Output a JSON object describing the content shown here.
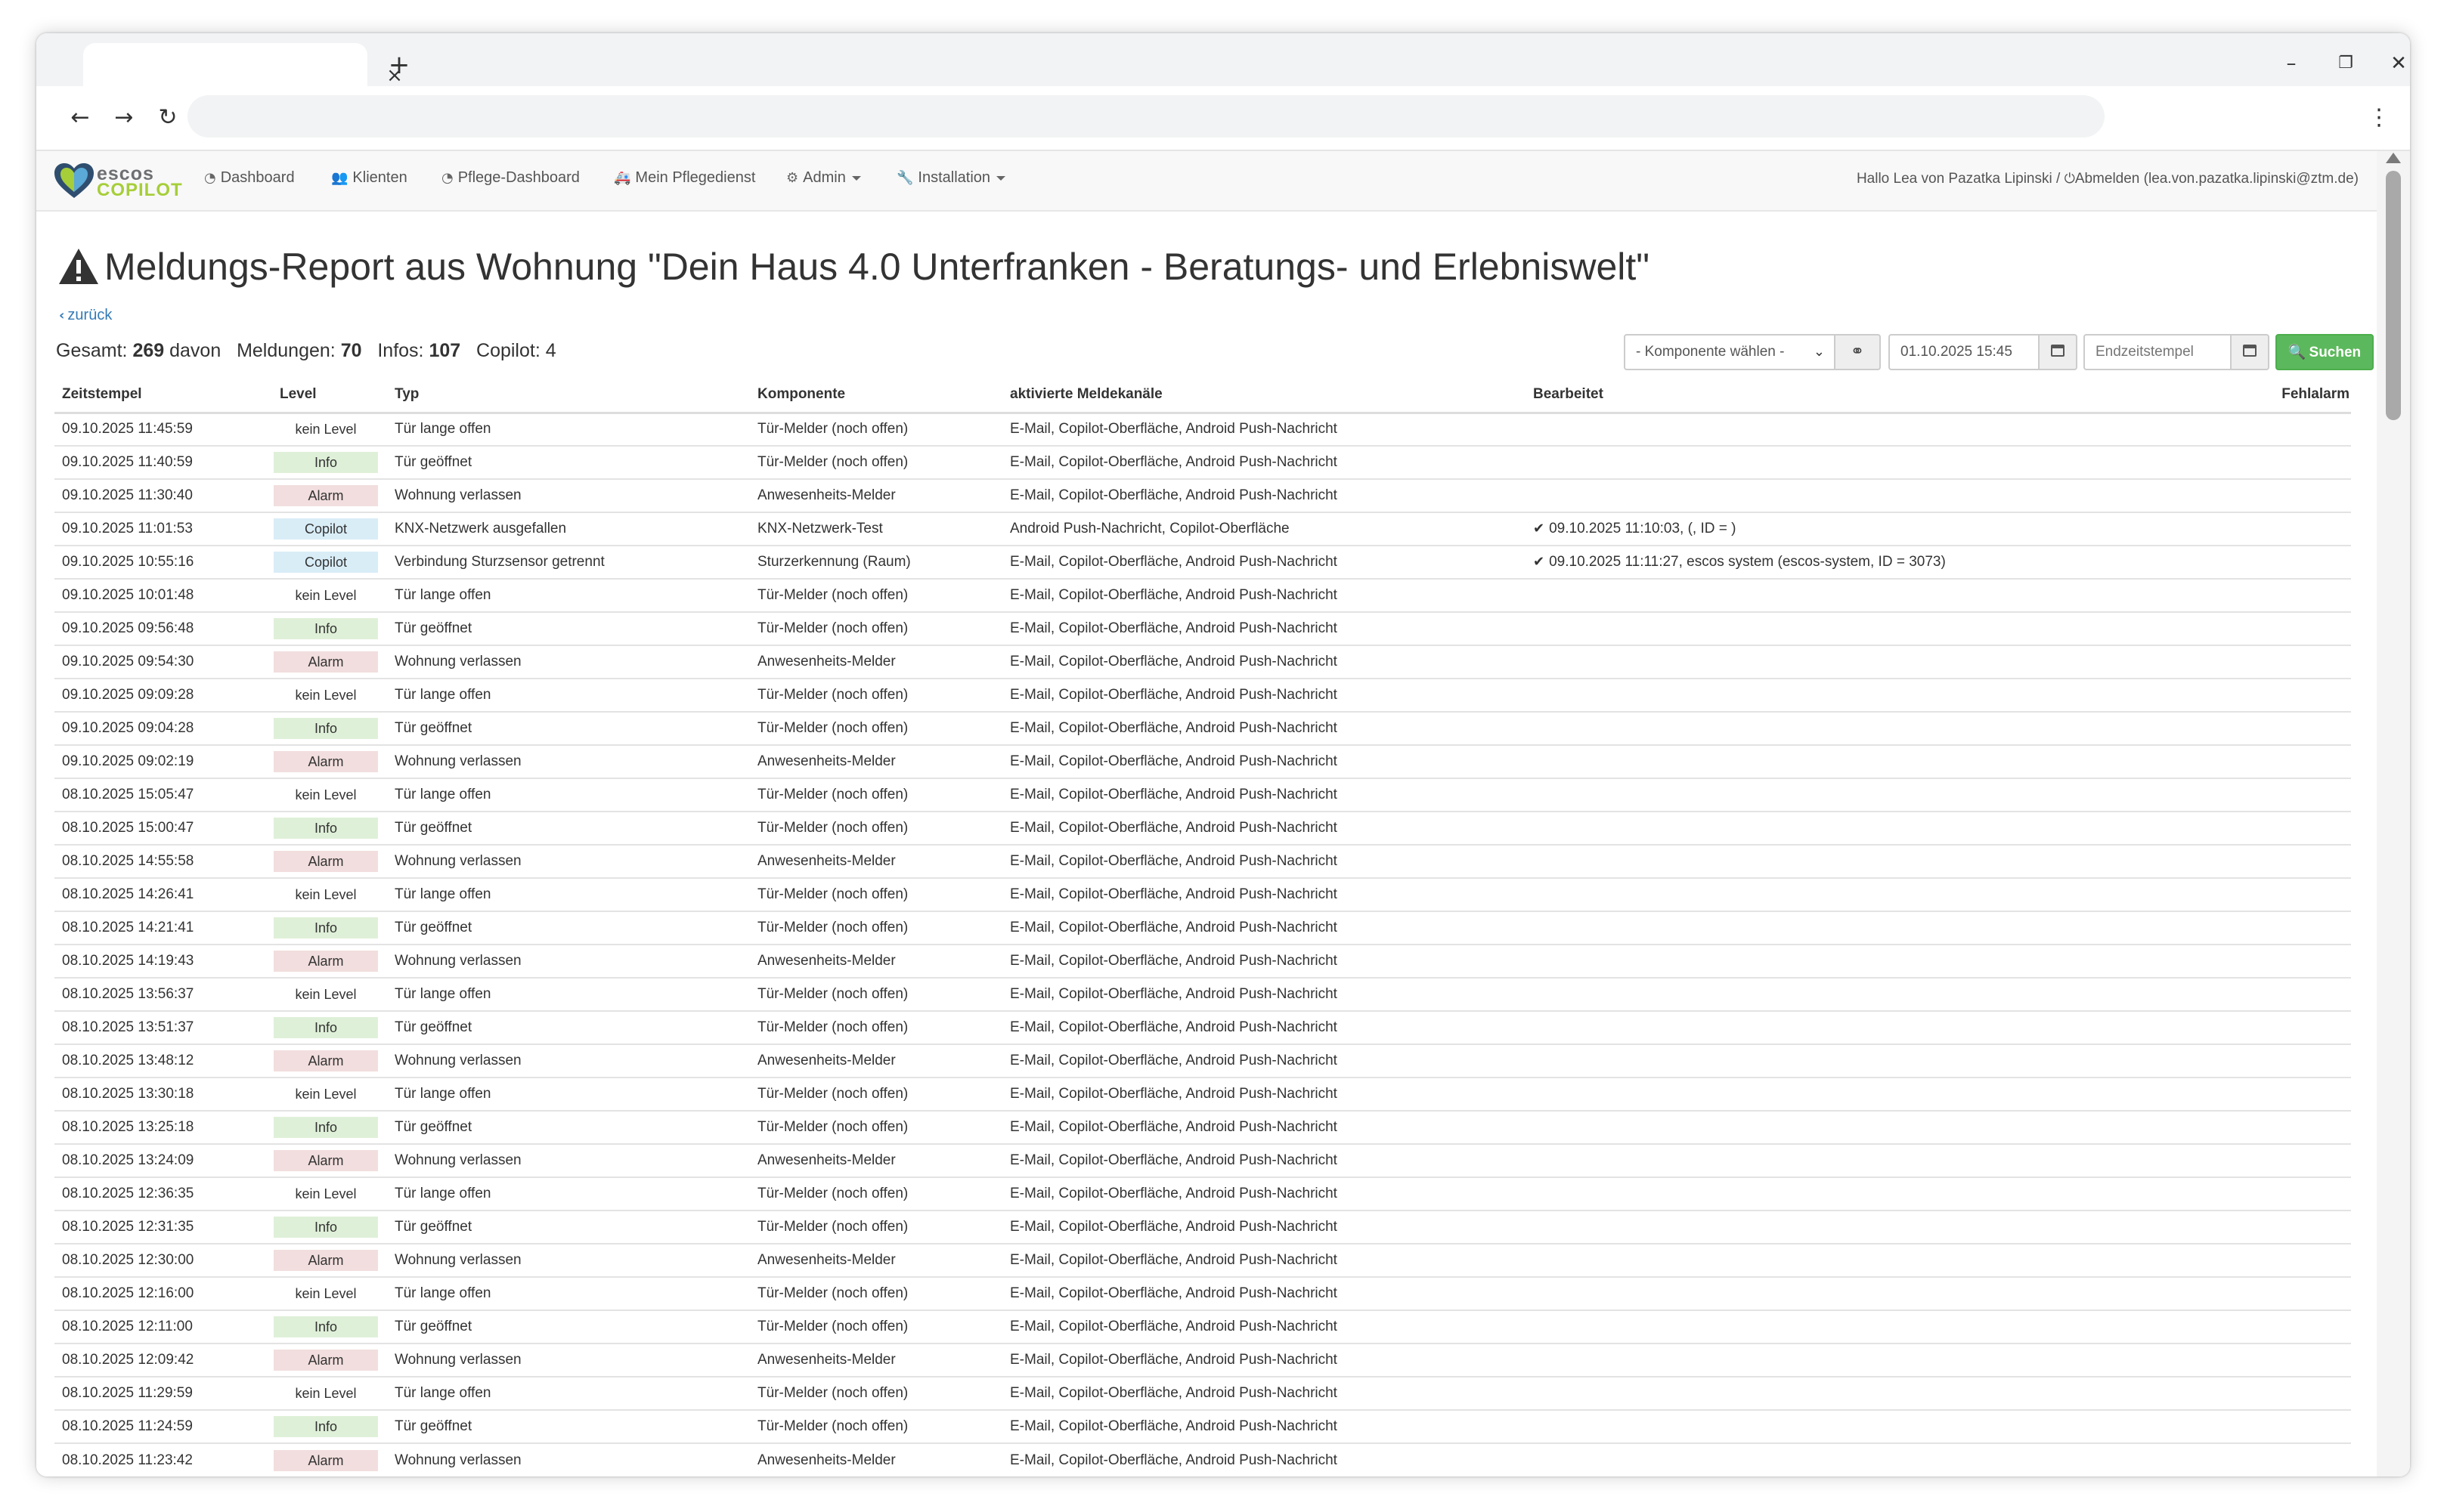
{
  "browser": {
    "tab_close": "×",
    "new_tab": "+",
    "address": "",
    "controls": {
      "minimize": "–",
      "restore": "❐",
      "close": "✕"
    }
  },
  "nav": {
    "logo_top": "escos",
    "logo_bottom": "COPILOT",
    "items": [
      {
        "label": "Dashboard",
        "icon": "dashboard-icon",
        "glyph": "◔",
        "dropdown": false
      },
      {
        "label": "Klienten",
        "icon": "users-icon",
        "glyph": "👥",
        "dropdown": false
      },
      {
        "label": "Pflege-Dashboard",
        "icon": "dashboard-icon",
        "glyph": "◔",
        "dropdown": false
      },
      {
        "label": "Mein Pflegedienst",
        "icon": "car-icon",
        "glyph": "🚑",
        "dropdown": false
      },
      {
        "label": "Admin",
        "icon": "gear-icon",
        "glyph": "⚙",
        "dropdown": true
      },
      {
        "label": "Installation",
        "icon": "wrench-icon",
        "glyph": "🔧",
        "dropdown": true
      }
    ],
    "greeting": "Hallo Lea von Pazatka Lipinski /",
    "logout": "Abmelden (lea.von.pazatka.lipinski@ztm.de)"
  },
  "page": {
    "title": "Meldungs-Report aus Wohnung \"Dein Haus 4.0 Unterfranken - Beratungs- und Erlebniswelt\"",
    "back": "zurück",
    "summary": {
      "total_label": "Gesamt:",
      "total": "269",
      "of_label": "davon",
      "messages_label": "Meldungen:",
      "messages": "70",
      "infos_label": "Infos:",
      "infos": "107",
      "copilot_label": "Copilot:",
      "copilot": "4"
    }
  },
  "filters": {
    "component_select": "- Komponente wählen -",
    "start": "01.10.2025 15:45",
    "end_placeholder": "Endzeitstempel",
    "search": "Suchen"
  },
  "table": {
    "headers": [
      "Zeitstempel",
      "Level",
      "Typ",
      "Komponente",
      "aktivierte Meldekanäle",
      "Bearbeitet",
      "Fehlalarm"
    ],
    "rows": [
      {
        "ts": "09.10.2025 11:45:59",
        "level": "kein Level",
        "type": "Tür lange offen",
        "comp": "Tür-Melder (noch offen)",
        "channels": "E-Mail, Copilot-Oberfläche, Android Push-Nachricht",
        "edited": ""
      },
      {
        "ts": "09.10.2025 11:40:59",
        "level": "Info",
        "type": "Tür geöffnet",
        "comp": "Tür-Melder (noch offen)",
        "channels": "E-Mail, Copilot-Oberfläche, Android Push-Nachricht",
        "edited": ""
      },
      {
        "ts": "09.10.2025 11:30:40",
        "level": "Alarm",
        "type": "Wohnung verlassen",
        "comp": "Anwesenheits-Melder",
        "channels": "E-Mail, Copilot-Oberfläche, Android Push-Nachricht",
        "edited": ""
      },
      {
        "ts": "09.10.2025 11:01:53",
        "level": "Copilot",
        "type": "KNX-Netzwerk ausgefallen",
        "comp": "KNX-Netzwerk-Test",
        "channels": "Android Push-Nachricht, Copilot-Oberfläche",
        "edited": "09.10.2025 11:10:03, (, ID = )"
      },
      {
        "ts": "09.10.2025 10:55:16",
        "level": "Copilot",
        "type": "Verbindung Sturzsensor getrennt",
        "comp": "Sturzerkennung (Raum)",
        "channels": "E-Mail, Copilot-Oberfläche, Android Push-Nachricht",
        "edited": "09.10.2025 11:11:27, escos system (escos-system, ID = 3073)"
      },
      {
        "ts": "09.10.2025 10:01:48",
        "level": "kein Level",
        "type": "Tür lange offen",
        "comp": "Tür-Melder (noch offen)",
        "channels": "E-Mail, Copilot-Oberfläche, Android Push-Nachricht",
        "edited": ""
      },
      {
        "ts": "09.10.2025 09:56:48",
        "level": "Info",
        "type": "Tür geöffnet",
        "comp": "Tür-Melder (noch offen)",
        "channels": "E-Mail, Copilot-Oberfläche, Android Push-Nachricht",
        "edited": ""
      },
      {
        "ts": "09.10.2025 09:54:30",
        "level": "Alarm",
        "type": "Wohnung verlassen",
        "comp": "Anwesenheits-Melder",
        "channels": "E-Mail, Copilot-Oberfläche, Android Push-Nachricht",
        "edited": ""
      },
      {
        "ts": "09.10.2025 09:09:28",
        "level": "kein Level",
        "type": "Tür lange offen",
        "comp": "Tür-Melder (noch offen)",
        "channels": "E-Mail, Copilot-Oberfläche, Android Push-Nachricht",
        "edited": ""
      },
      {
        "ts": "09.10.2025 09:04:28",
        "level": "Info",
        "type": "Tür geöffnet",
        "comp": "Tür-Melder (noch offen)",
        "channels": "E-Mail, Copilot-Oberfläche, Android Push-Nachricht",
        "edited": ""
      },
      {
        "ts": "09.10.2025 09:02:19",
        "level": "Alarm",
        "type": "Wohnung verlassen",
        "comp": "Anwesenheits-Melder",
        "channels": "E-Mail, Copilot-Oberfläche, Android Push-Nachricht",
        "edited": ""
      },
      {
        "ts": "08.10.2025 15:05:47",
        "level": "kein Level",
        "type": "Tür lange offen",
        "comp": "Tür-Melder (noch offen)",
        "channels": "E-Mail, Copilot-Oberfläche, Android Push-Nachricht",
        "edited": ""
      },
      {
        "ts": "08.10.2025 15:00:47",
        "level": "Info",
        "type": "Tür geöffnet",
        "comp": "Tür-Melder (noch offen)",
        "channels": "E-Mail, Copilot-Oberfläche, Android Push-Nachricht",
        "edited": ""
      },
      {
        "ts": "08.10.2025 14:55:58",
        "level": "Alarm",
        "type": "Wohnung verlassen",
        "comp": "Anwesenheits-Melder",
        "channels": "E-Mail, Copilot-Oberfläche, Android Push-Nachricht",
        "edited": ""
      },
      {
        "ts": "08.10.2025 14:26:41",
        "level": "kein Level",
        "type": "Tür lange offen",
        "comp": "Tür-Melder (noch offen)",
        "channels": "E-Mail, Copilot-Oberfläche, Android Push-Nachricht",
        "edited": ""
      },
      {
        "ts": "08.10.2025 14:21:41",
        "level": "Info",
        "type": "Tür geöffnet",
        "comp": "Tür-Melder (noch offen)",
        "channels": "E-Mail, Copilot-Oberfläche, Android Push-Nachricht",
        "edited": ""
      },
      {
        "ts": "08.10.2025 14:19:43",
        "level": "Alarm",
        "type": "Wohnung verlassen",
        "comp": "Anwesenheits-Melder",
        "channels": "E-Mail, Copilot-Oberfläche, Android Push-Nachricht",
        "edited": ""
      },
      {
        "ts": "08.10.2025 13:56:37",
        "level": "kein Level",
        "type": "Tür lange offen",
        "comp": "Tür-Melder (noch offen)",
        "channels": "E-Mail, Copilot-Oberfläche, Android Push-Nachricht",
        "edited": ""
      },
      {
        "ts": "08.10.2025 13:51:37",
        "level": "Info",
        "type": "Tür geöffnet",
        "comp": "Tür-Melder (noch offen)",
        "channels": "E-Mail, Copilot-Oberfläche, Android Push-Nachricht",
        "edited": ""
      },
      {
        "ts": "08.10.2025 13:48:12",
        "level": "Alarm",
        "type": "Wohnung verlassen",
        "comp": "Anwesenheits-Melder",
        "channels": "E-Mail, Copilot-Oberfläche, Android Push-Nachricht",
        "edited": ""
      },
      {
        "ts": "08.10.2025 13:30:18",
        "level": "kein Level",
        "type": "Tür lange offen",
        "comp": "Tür-Melder (noch offen)",
        "channels": "E-Mail, Copilot-Oberfläche, Android Push-Nachricht",
        "edited": ""
      },
      {
        "ts": "08.10.2025 13:25:18",
        "level": "Info",
        "type": "Tür geöffnet",
        "comp": "Tür-Melder (noch offen)",
        "channels": "E-Mail, Copilot-Oberfläche, Android Push-Nachricht",
        "edited": ""
      },
      {
        "ts": "08.10.2025 13:24:09",
        "level": "Alarm",
        "type": "Wohnung verlassen",
        "comp": "Anwesenheits-Melder",
        "channels": "E-Mail, Copilot-Oberfläche, Android Push-Nachricht",
        "edited": ""
      },
      {
        "ts": "08.10.2025 12:36:35",
        "level": "kein Level",
        "type": "Tür lange offen",
        "comp": "Tür-Melder (noch offen)",
        "channels": "E-Mail, Copilot-Oberfläche, Android Push-Nachricht",
        "edited": ""
      },
      {
        "ts": "08.10.2025 12:31:35",
        "level": "Info",
        "type": "Tür geöffnet",
        "comp": "Tür-Melder (noch offen)",
        "channels": "E-Mail, Copilot-Oberfläche, Android Push-Nachricht",
        "edited": ""
      },
      {
        "ts": "08.10.2025 12:30:00",
        "level": "Alarm",
        "type": "Wohnung verlassen",
        "comp": "Anwesenheits-Melder",
        "channels": "E-Mail, Copilot-Oberfläche, Android Push-Nachricht",
        "edited": ""
      },
      {
        "ts": "08.10.2025 12:16:00",
        "level": "kein Level",
        "type": "Tür lange offen",
        "comp": "Tür-Melder (noch offen)",
        "channels": "E-Mail, Copilot-Oberfläche, Android Push-Nachricht",
        "edited": ""
      },
      {
        "ts": "08.10.2025 12:11:00",
        "level": "Info",
        "type": "Tür geöffnet",
        "comp": "Tür-Melder (noch offen)",
        "channels": "E-Mail, Copilot-Oberfläche, Android Push-Nachricht",
        "edited": ""
      },
      {
        "ts": "08.10.2025 12:09:42",
        "level": "Alarm",
        "type": "Wohnung verlassen",
        "comp": "Anwesenheits-Melder",
        "channels": "E-Mail, Copilot-Oberfläche, Android Push-Nachricht",
        "edited": ""
      },
      {
        "ts": "08.10.2025 11:29:59",
        "level": "kein Level",
        "type": "Tür lange offen",
        "comp": "Tür-Melder (noch offen)",
        "channels": "E-Mail, Copilot-Oberfläche, Android Push-Nachricht",
        "edited": ""
      },
      {
        "ts": "08.10.2025 11:24:59",
        "level": "Info",
        "type": "Tür geöffnet",
        "comp": "Tür-Melder (noch offen)",
        "channels": "E-Mail, Copilot-Oberfläche, Android Push-Nachricht",
        "edited": ""
      },
      {
        "ts": "08.10.2025 11:23:42",
        "level": "Alarm",
        "type": "Wohnung verlassen",
        "comp": "Anwesenheits-Melder",
        "channels": "E-Mail, Copilot-Oberfläche, Android Push-Nachricht",
        "edited": ""
      }
    ]
  },
  "colors": {
    "info_badge": "#dff0d8",
    "alarm_badge": "#f2dede",
    "copilot_badge": "#d9edf7",
    "search_button": "#5cb85c",
    "link": "#337ab7",
    "logo_green": "#a6ce39"
  }
}
